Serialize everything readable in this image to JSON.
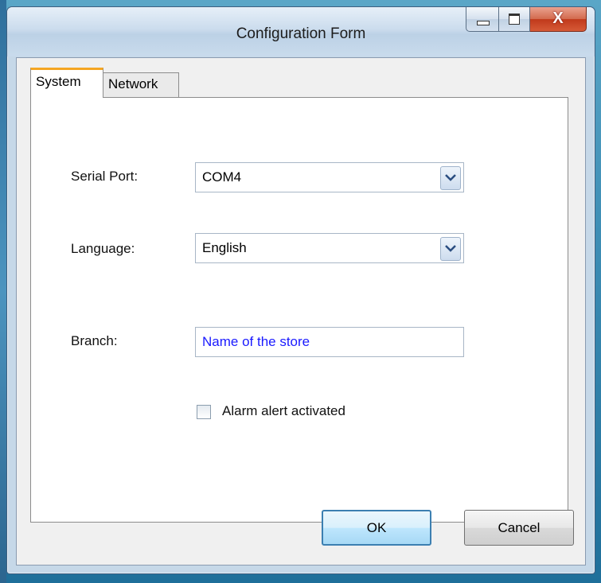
{
  "window": {
    "title": "Configuration Form",
    "close_glyph": "X"
  },
  "tabs": [
    {
      "label": "System",
      "active": true
    },
    {
      "label": "Network",
      "active": false
    }
  ],
  "form": {
    "serial_port": {
      "label": "Serial Port:",
      "value": "COM4"
    },
    "language": {
      "label": "Language:",
      "value": "English"
    },
    "branch": {
      "label": "Branch:",
      "value": "Name of the store"
    },
    "alarm": {
      "label": "Alarm alert activated",
      "checked": false
    }
  },
  "buttons": {
    "ok": "OK",
    "cancel": "Cancel"
  },
  "colors": {
    "active_tab_accent": "#f5a623",
    "branch_text": "#1a1aff",
    "close_button": "#c0391b"
  }
}
